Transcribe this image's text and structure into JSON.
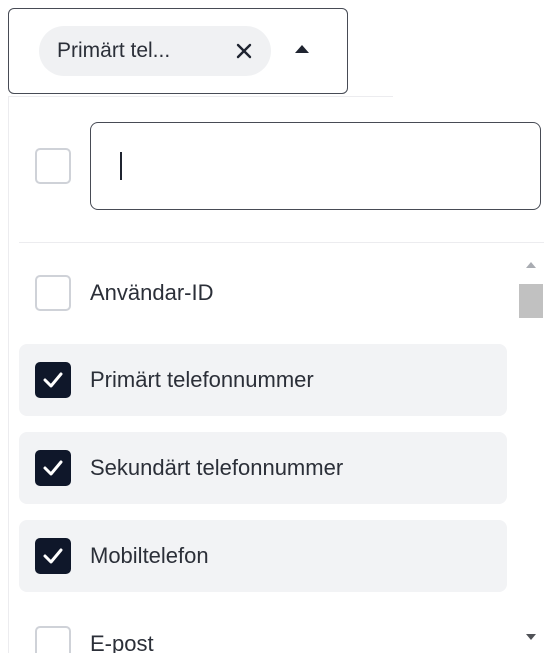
{
  "select": {
    "chip_label": "Primärt tel...",
    "chip_remove_icon": "close-icon",
    "toggle_icon": "caret-up-icon"
  },
  "dropdown": {
    "select_all_checked": false,
    "search": {
      "value": "",
      "placeholder": ""
    },
    "options": [
      {
        "label": "Användar-ID",
        "checked": false
      },
      {
        "label": "Primärt telefonnummer",
        "checked": true
      },
      {
        "label": "Sekundärt telefonnummer",
        "checked": true
      },
      {
        "label": "Mobiltelefon",
        "checked": true
      },
      {
        "label": "E-post",
        "checked": false
      }
    ],
    "scrollbar": {
      "up_icon": "scroll-up-arrow-icon",
      "down_icon": "scroll-down-arrow-icon"
    }
  },
  "colors": {
    "checked_fill": "#0f172a",
    "selected_row_bg": "#f2f3f5",
    "chip_bg": "#f0f1f3",
    "border": "#474b55"
  }
}
